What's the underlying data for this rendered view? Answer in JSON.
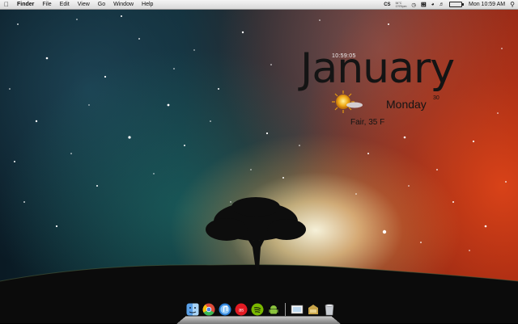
{
  "menubar": {
    "apple_icon": "apple-icon",
    "items": [
      "Finder",
      "File",
      "Edit",
      "View",
      "Go",
      "Window",
      "Help"
    ],
    "status": {
      "app_glyph": "CS",
      "temp_lines": [
        "54°C",
        "1797rpm"
      ],
      "clock": "Mon 10:59 AM"
    }
  },
  "widget": {
    "time": "10:59:05",
    "month": "January",
    "day": "Monday",
    "date": "30",
    "weather": "Fair, 35 F",
    "weather_icon": "sun-cloud-icon"
  },
  "dock": {
    "icons": [
      "finder-icon",
      "chrome-icon",
      "itunes-icon",
      "lastfm-icon",
      "spotify-icon",
      "android-icon",
      "preview-icon",
      "downloads-icon",
      "trash-icon"
    ]
  }
}
